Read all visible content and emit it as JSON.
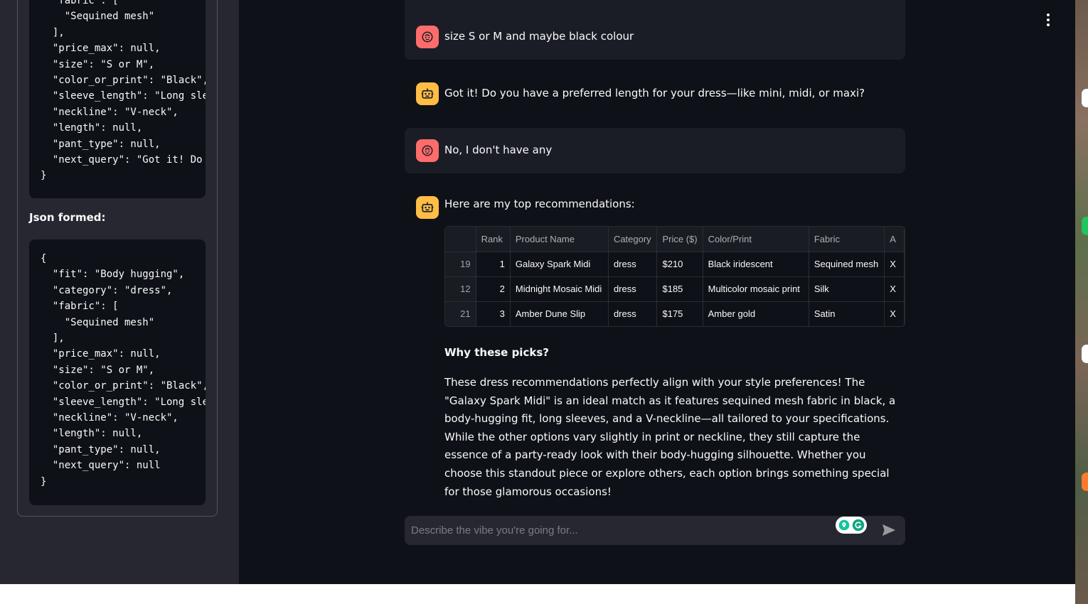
{
  "sidebar": {
    "code_block_1_lines": "  \"fabric\": [\n    \"Sequined mesh\"\n  ],\n  \"price_max\": null,\n  \"size\": \"S or M\",\n  \"color_or_print\": \"Black\",\n  \"sleeve_length\": \"Long sle\n  \"neckline\": \"V-neck\",\n  \"length\": null,\n  \"pant_type\": null,\n  \"next_query\": \"Got it! Do\n}",
    "json_formed_label": "Json formed:",
    "code_block_2_lines": "{\n  \"fit\": \"Body hugging\",\n  \"category\": \"dress\",\n  \"fabric\": [\n    \"Sequined mesh\"\n  ],\n  \"price_max\": null,\n  \"size\": \"S or M\",\n  \"color_or_print\": \"Black\",\n  \"sleeve_length\": \"Long sle\n  \"neckline\": \"V-neck\",\n  \"length\": null,\n  \"pant_type\": null,\n  \"next_query\": null\n}"
  },
  "chat": {
    "messages": [
      {
        "role": "user",
        "text": "size S or M and maybe black colour"
      },
      {
        "role": "assistant",
        "text": "Got it! Do you have a preferred length for your dress—like mini, midi, or maxi?"
      },
      {
        "role": "user",
        "text": "No, I don't have any"
      },
      {
        "role": "assistant",
        "text": "Here are my top recommendations:"
      }
    ],
    "table": {
      "headers": [
        "",
        "Rank",
        "Product Name",
        "Category",
        "Price ($)",
        "Color/Print",
        "Fabric",
        "A"
      ],
      "rows": [
        [
          "19",
          "1",
          "Galaxy Spark Midi",
          "dress",
          "$210",
          "Black iridescent",
          "Sequined mesh",
          "X"
        ],
        [
          "12",
          "2",
          "Midnight Mosaic Midi",
          "dress",
          "$185",
          "Multicolor mosaic print",
          "Silk",
          "X"
        ],
        [
          "21",
          "3",
          "Amber Dune Slip",
          "dress",
          "$175",
          "Amber gold",
          "Satin",
          "X"
        ]
      ]
    },
    "why_title": "Why these picks?",
    "why_body": "These dress recommendations perfectly align with your style preferences! The \"Galaxy Spark Midi\" is an ideal match as it features sequined mesh fabric in black, a body-hugging fit, long sleeves, and a V-neckline—all tailored to your specifications. While the other options vary slightly in print or neckline, they still capture the essence of a party-ready look with their body-hugging silhouette. Whether you choose this standout piece or explore others, each option brings something special for those glamorous occasions!"
  },
  "input": {
    "placeholder": "Describe the vibe you're going for..."
  },
  "colors": {
    "background": "#0e1117",
    "sidebar": "#262730",
    "user_avatar": "#ff6c6c",
    "bot_avatar": "#ffbd45"
  },
  "icons": {
    "user_avatar": "face-icon",
    "bot_avatar": "robot-icon",
    "send": "send-arrow-icon",
    "menu": "vertical-dots-icon"
  }
}
